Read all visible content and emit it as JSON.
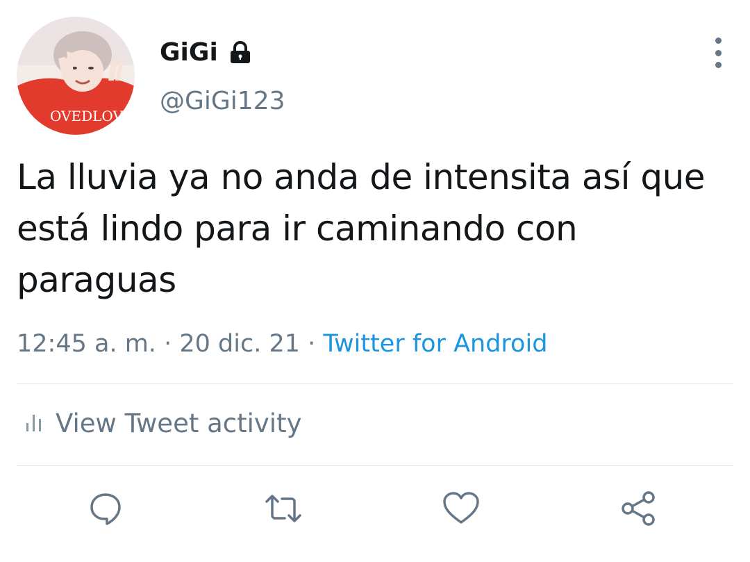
{
  "user": {
    "display_name": "GiGi",
    "handle": "@GiGi123",
    "protected_icon": "lock-icon",
    "avatar_text": "OVEDLOVE"
  },
  "tweet": {
    "text": "La lluvia ya no anda de intensita así que está lindo para ir caminando con paraguas",
    "time": "12:45 a. m.",
    "separator": "·",
    "date": "20 dic. 21",
    "source": "Twitter for Android"
  },
  "activity": {
    "label": "View Tweet activity",
    "icon": "bar-chart-icon"
  },
  "actions": {
    "icons": [
      "reply-icon",
      "retweet-icon",
      "like-icon",
      "share-icon"
    ]
  },
  "colors": {
    "primary_text": "#14171a",
    "secondary_text": "#657786",
    "link": "#1b95e0",
    "divider": "#e1e8ed"
  }
}
